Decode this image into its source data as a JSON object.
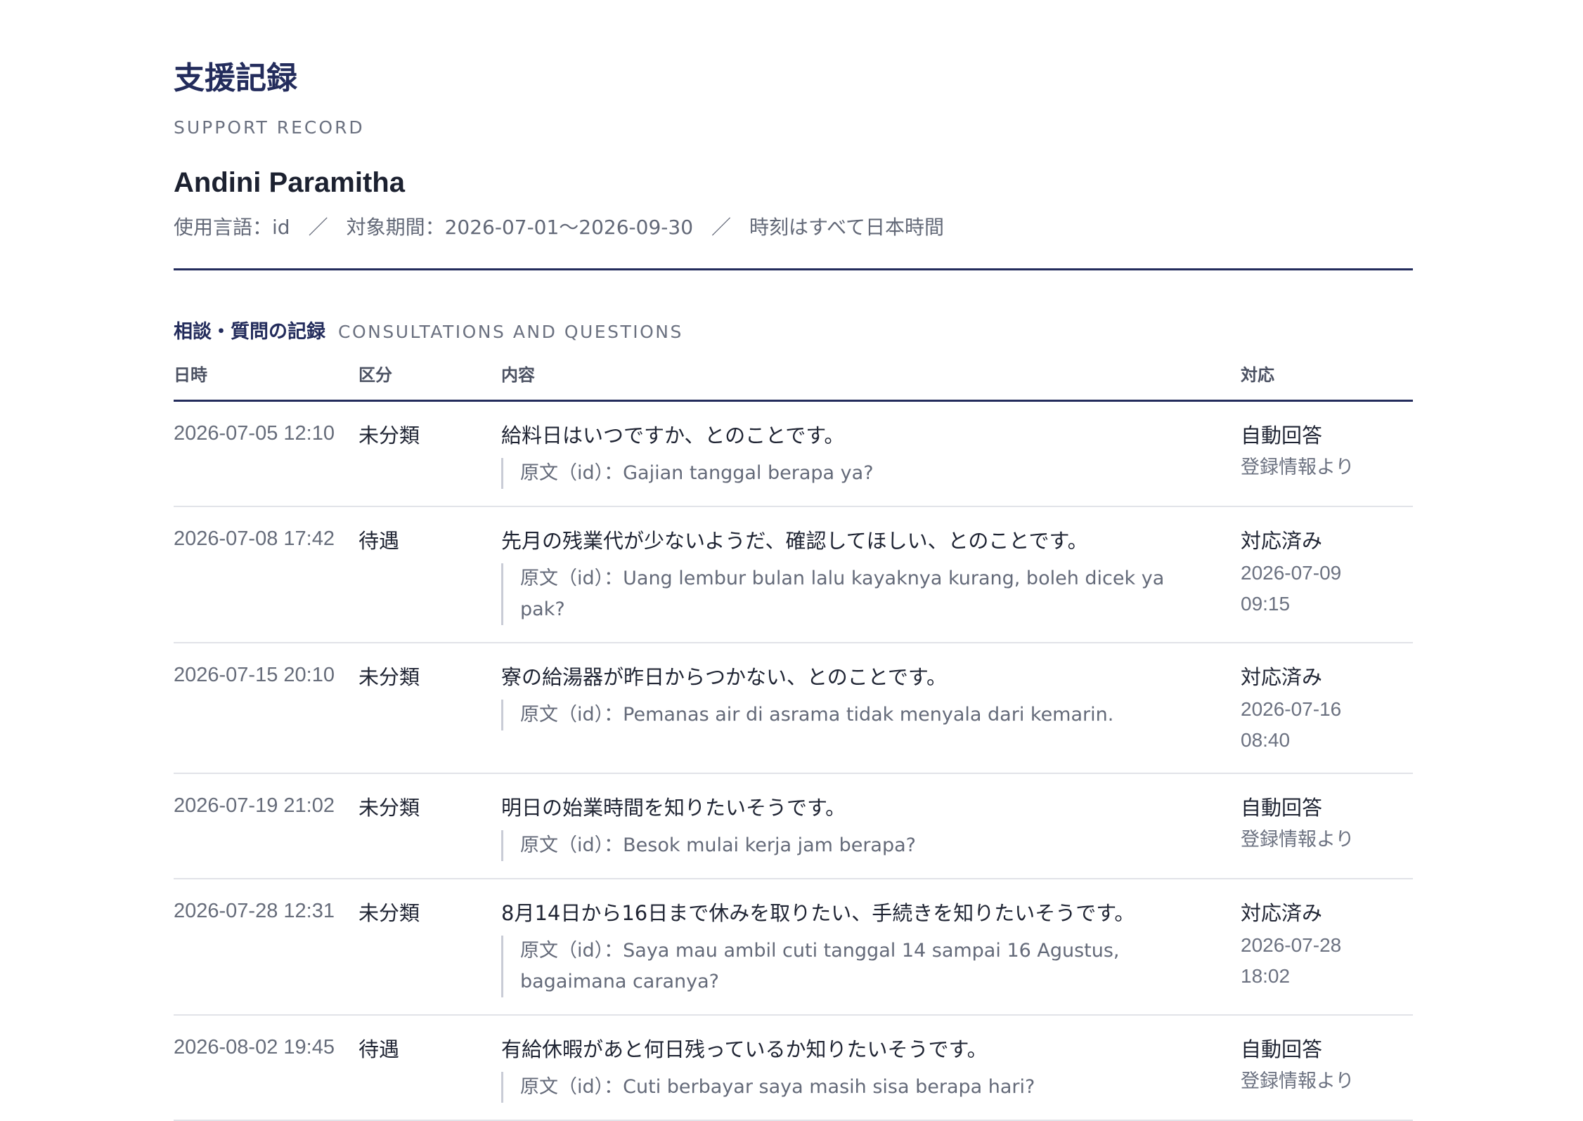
{
  "header": {
    "title": "支援記録",
    "subtitle": "SUPPORT RECORD",
    "person_name": "Andini Paramitha",
    "meta": {
      "language": "使用言語：id",
      "separator": "／",
      "period": "対象期間：2026-07-01〜2026-09-30",
      "timezone_note": "時刻はすべて日本時間"
    }
  },
  "section": {
    "title": "相談・質問の記録",
    "subtitle": "CONSULTATIONS AND QUESTIONS",
    "columns": {
      "datetime": "日時",
      "category": "区分",
      "content": "内容",
      "response": "対応"
    },
    "rows": [
      {
        "datetime": "2026-07-05 12:10",
        "category": "未分類",
        "summary": "給料日はいつですか、とのことです。",
        "original": "原文（id）：Gajian tanggal berapa ya?",
        "status": "自動回答",
        "detail": "登録情報より"
      },
      {
        "datetime": "2026-07-08 17:42",
        "category": "待遇",
        "summary": "先月の残業代が少ないようだ、確認してほしい、とのことです。",
        "original": "原文（id）：Uang lembur bulan lalu kayaknya kurang, boleh dicek ya pak?",
        "status": "対応済み",
        "detail_date": "2026-07-09",
        "detail_time": "09:15"
      },
      {
        "datetime": "2026-07-15 20:10",
        "category": "未分類",
        "summary": "寮の給湯器が昨日からつかない、とのことです。",
        "original": "原文（id）：Pemanas air di asrama tidak menyala dari kemarin.",
        "status": "対応済み",
        "detail_date": "2026-07-16",
        "detail_time": "08:40"
      },
      {
        "datetime": "2026-07-19 21:02",
        "category": "未分類",
        "summary": "明日の始業時間を知りたいそうです。",
        "original": "原文（id）：Besok mulai kerja jam berapa?",
        "status": "自動回答",
        "detail": "登録情報より"
      },
      {
        "datetime": "2026-07-28 12:31",
        "category": "未分類",
        "summary": "8月14日から16日まで休みを取りたい、手続きを知りたいそうです。",
        "original": "原文（id）：Saya mau ambil cuti tanggal 14 sampai 16 Agustus, bagaimana caranya?",
        "status": "対応済み",
        "detail_date": "2026-07-28",
        "detail_time": "18:02"
      },
      {
        "datetime": "2026-08-02 19:45",
        "category": "待遇",
        "summary": "有給休暇があと何日残っているか知りたいそうです。",
        "original": "原文（id）：Cuti berbayar saya masih sisa berapa hari?",
        "status": "自動回答",
        "detail": "登録情報より"
      }
    ]
  },
  "colors": {
    "accent": "#232c5c",
    "text": "#1f2433",
    "muted": "#6b7180",
    "row_divider": "#e1e3e8",
    "quote_bar": "#c9ccd6"
  }
}
